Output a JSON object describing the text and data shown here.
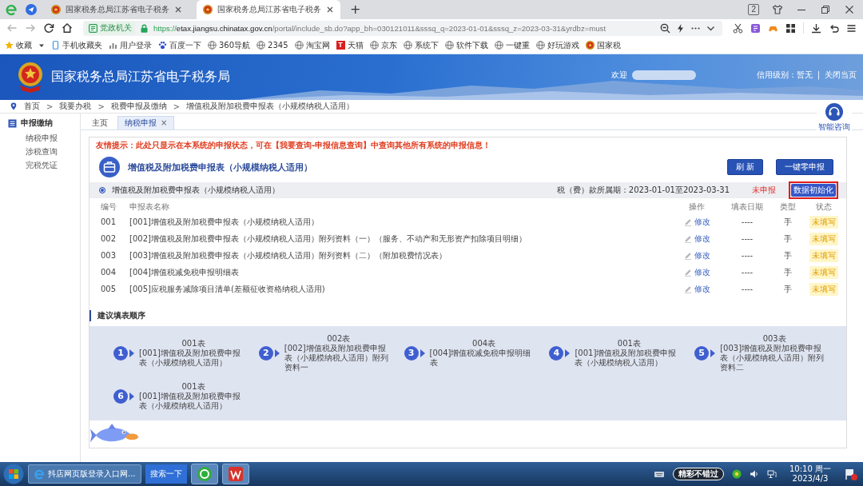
{
  "browser": {
    "tabs": [
      {
        "title": "国家税务总局江苏省电子税务",
        "selected": false
      },
      {
        "title": "国家税务总局江苏省电子税务",
        "selected": true
      }
    ],
    "new_tab": "+",
    "window_counter": "2",
    "address": {
      "badge": "党政机关",
      "scheme": "https://",
      "host": "etax.jiangsu.chinatax.gov.cn",
      "path": "/portal/include_sb.do?app_bh=030121011&sssq_q=2023-01-01&sssq_z=2023-03-31&yrdbz=must"
    },
    "favorites": {
      "label": "收藏"
    },
    "bookmarks": [
      {
        "label": "手机收藏夹",
        "kind": "phone"
      },
      {
        "label": "用户登录",
        "kind": "bars"
      },
      {
        "label": "百度一下",
        "kind": "paw"
      },
      {
        "label": "360导航",
        "kind": "globe"
      },
      {
        "label": "2345",
        "kind": "globe"
      },
      {
        "label": "淘宝网",
        "kind": "globe"
      },
      {
        "label": "天猫",
        "kind": "tile",
        "glyph": "T"
      },
      {
        "label": "京东",
        "kind": "globe"
      },
      {
        "label": "系统下",
        "kind": "globe"
      },
      {
        "label": "软件下载",
        "kind": "globe"
      },
      {
        "label": "一键重",
        "kind": "globe"
      },
      {
        "label": "好玩游戏",
        "kind": "globe"
      },
      {
        "label": "国家税",
        "kind": "emblem"
      }
    ]
  },
  "site": {
    "title": "国家税务总局江苏省电子税务局",
    "welcome": "欢迎",
    "credit": "信用级别：暂无",
    "separator": "|",
    "close_link": "关闭当页"
  },
  "breadcrumb": {
    "separator": ">",
    "items": [
      "首页",
      "我要办税",
      "税费申报及缴纳",
      "增值税及附加税费申报表（小规模纳税人适用）"
    ]
  },
  "sidebar": {
    "group": "申报缴纳",
    "items": [
      {
        "label": "纳税申报"
      },
      {
        "label": "涉税查询"
      },
      {
        "label": "完税凭证"
      }
    ]
  },
  "content_tabs": [
    {
      "label": "主页",
      "selected": false
    },
    {
      "label": "纳税申报",
      "selected": true,
      "close": "×"
    }
  ],
  "assistant": {
    "label": "智能咨询"
  },
  "panel": {
    "notice": "友情提示：此处只显示在本系统的申报状态，可在【我要查询-申报信息查询】中查询其他所有系统的申报信息！",
    "title": "增值税及附加税费申报表（小规模纳税人适用）",
    "buttons": [
      "刷 新",
      "一键零申报"
    ],
    "declaration": {
      "selected": true,
      "name": "增值税及附加税费申报表（小规模纳税人适用）",
      "period": "税（费）款所属期：2023-01-01至2023-03-31",
      "status": "未申报",
      "action": "数据初始化",
      "highlighted": true
    },
    "table": {
      "columns": [
        "编号",
        "申报表名称",
        "操作",
        "填表日期",
        "类型",
        "状态"
      ],
      "rows": [
        {
          "no": "001",
          "name": "[001]增值税及附加税费申报表（小规模纳税人适用）",
          "action": "修改",
          "date": "----",
          "type": "手",
          "status": "未填写"
        },
        {
          "no": "002",
          "name": "[002]增值税及附加税费申报表（小规模纳税人适用）附列资料（一）（服务、不动产和无形资产扣除项目明细）",
          "action": "修改",
          "date": "----",
          "type": "手",
          "status": "未填写"
        },
        {
          "no": "003",
          "name": "[003]增值税及附加税费申报表（小规模纳税人适用）附列资料（二）（附加税费情况表）",
          "action": "修改",
          "date": "----",
          "type": "手",
          "status": "未填写"
        },
        {
          "no": "004",
          "name": "[004]增值税减免税申报明细表",
          "action": "修改",
          "date": "----",
          "type": "手",
          "status": "未填写"
        },
        {
          "no": "005",
          "name": "[005]应税服务减除项目清单(差额征收资格纳税人适用)",
          "action": "修改",
          "date": "----",
          "type": "手",
          "status": "未填写"
        }
      ]
    },
    "order_title": "建议填表顺序",
    "steps": [
      {
        "number": "1",
        "form": "001表",
        "desc": "[001]增值税及附加税费申报表（小规模纳税人适用）"
      },
      {
        "number": "2",
        "form": "002表",
        "desc": "[002]增值税及附加税费申报表（小规模纳税人适用）附列资料一"
      },
      {
        "number": "3",
        "form": "004表",
        "desc": "[004]增值税减免税申报明细表"
      },
      {
        "number": "4",
        "form": "001表",
        "desc": "[001]增值税及附加税费申报表（小规模纳税人适用）"
      },
      {
        "number": "5",
        "form": "003表",
        "desc": "[003]增值税及附加税费申报表（小规模纳税人适用）附列资料二"
      },
      {
        "number": "6",
        "form": "001表",
        "desc": "[001]增值税及附加税费申报表（小规模纳税人适用）"
      }
    ]
  },
  "taskbar": {
    "task": "抖店网页版登录入口网...",
    "search": "搜索一下",
    "promo": "精彩不错过",
    "time": "10:10 周一",
    "date": "2023/4/3"
  }
}
